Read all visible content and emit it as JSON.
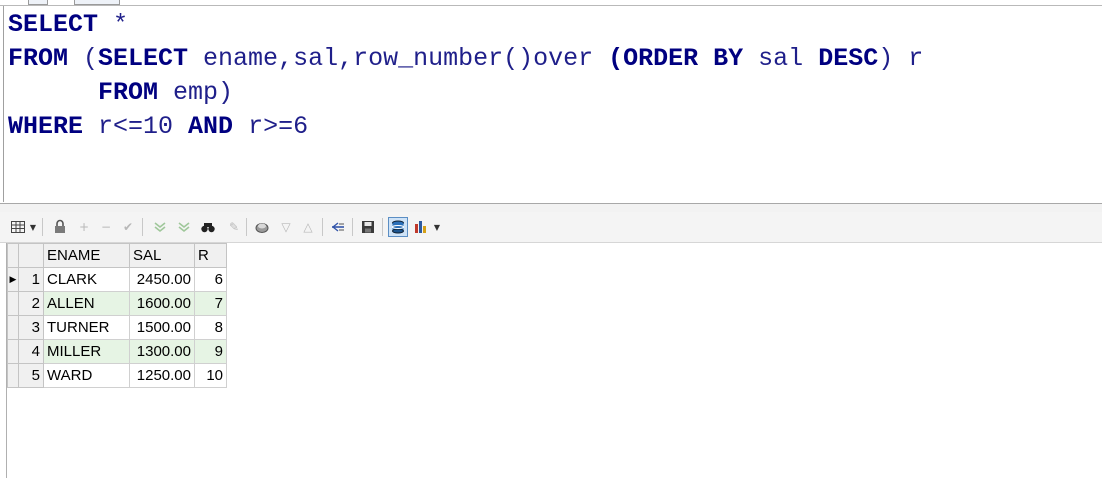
{
  "sql": {
    "line1": {
      "kw1": "SELECT",
      "tx1": " *"
    },
    "line2": {
      "kw1": "FROM",
      "tx1": " (",
      "kw2": "SELECT",
      "tx2": " ename,sal,row_number()over ",
      "tx3": "(",
      "kw3": "ORDER BY",
      "tx4": " sal ",
      "kw4": "DESC",
      "tx5": ") r"
    },
    "line3": {
      "indent": "      ",
      "kw1": "FROM",
      "tx1": " emp)"
    },
    "line4": {
      "kw1": "WHERE",
      "tx1": " r<=10 ",
      "kw2": "AND",
      "tx2": " r>=6"
    }
  },
  "toolbar": {
    "icons": [
      "grid-menu-icon",
      "lock-icon",
      "add-record-icon",
      "delete-record-icon",
      "post-edit-icon",
      "filter-icon",
      "clear-filter-icon",
      "find-icon",
      "edit-icon",
      "query-icon",
      "sort-down-icon",
      "sort-up-icon",
      "export-icon",
      "save-icon",
      "record-view-icon",
      "chart-icon"
    ]
  },
  "results": {
    "columns": [
      "ENAME",
      "SAL",
      "R"
    ],
    "current_row_marker": "▶",
    "rows": [
      {
        "num": "1",
        "ename": "CLARK",
        "sal": "2450.00",
        "r": "6"
      },
      {
        "num": "2",
        "ename": "ALLEN",
        "sal": "1600.00",
        "r": "7"
      },
      {
        "num": "3",
        "ename": "TURNER",
        "sal": "1500.00",
        "r": "8"
      },
      {
        "num": "4",
        "ename": "MILLER",
        "sal": "1300.00",
        "r": "9"
      },
      {
        "num": "5",
        "ename": "WARD",
        "sal": "1250.00",
        "r": "10"
      }
    ]
  },
  "colors": {
    "keyword": "#000080",
    "alt_row": "#e6f4e4",
    "active_button": "#cfe3f7"
  }
}
